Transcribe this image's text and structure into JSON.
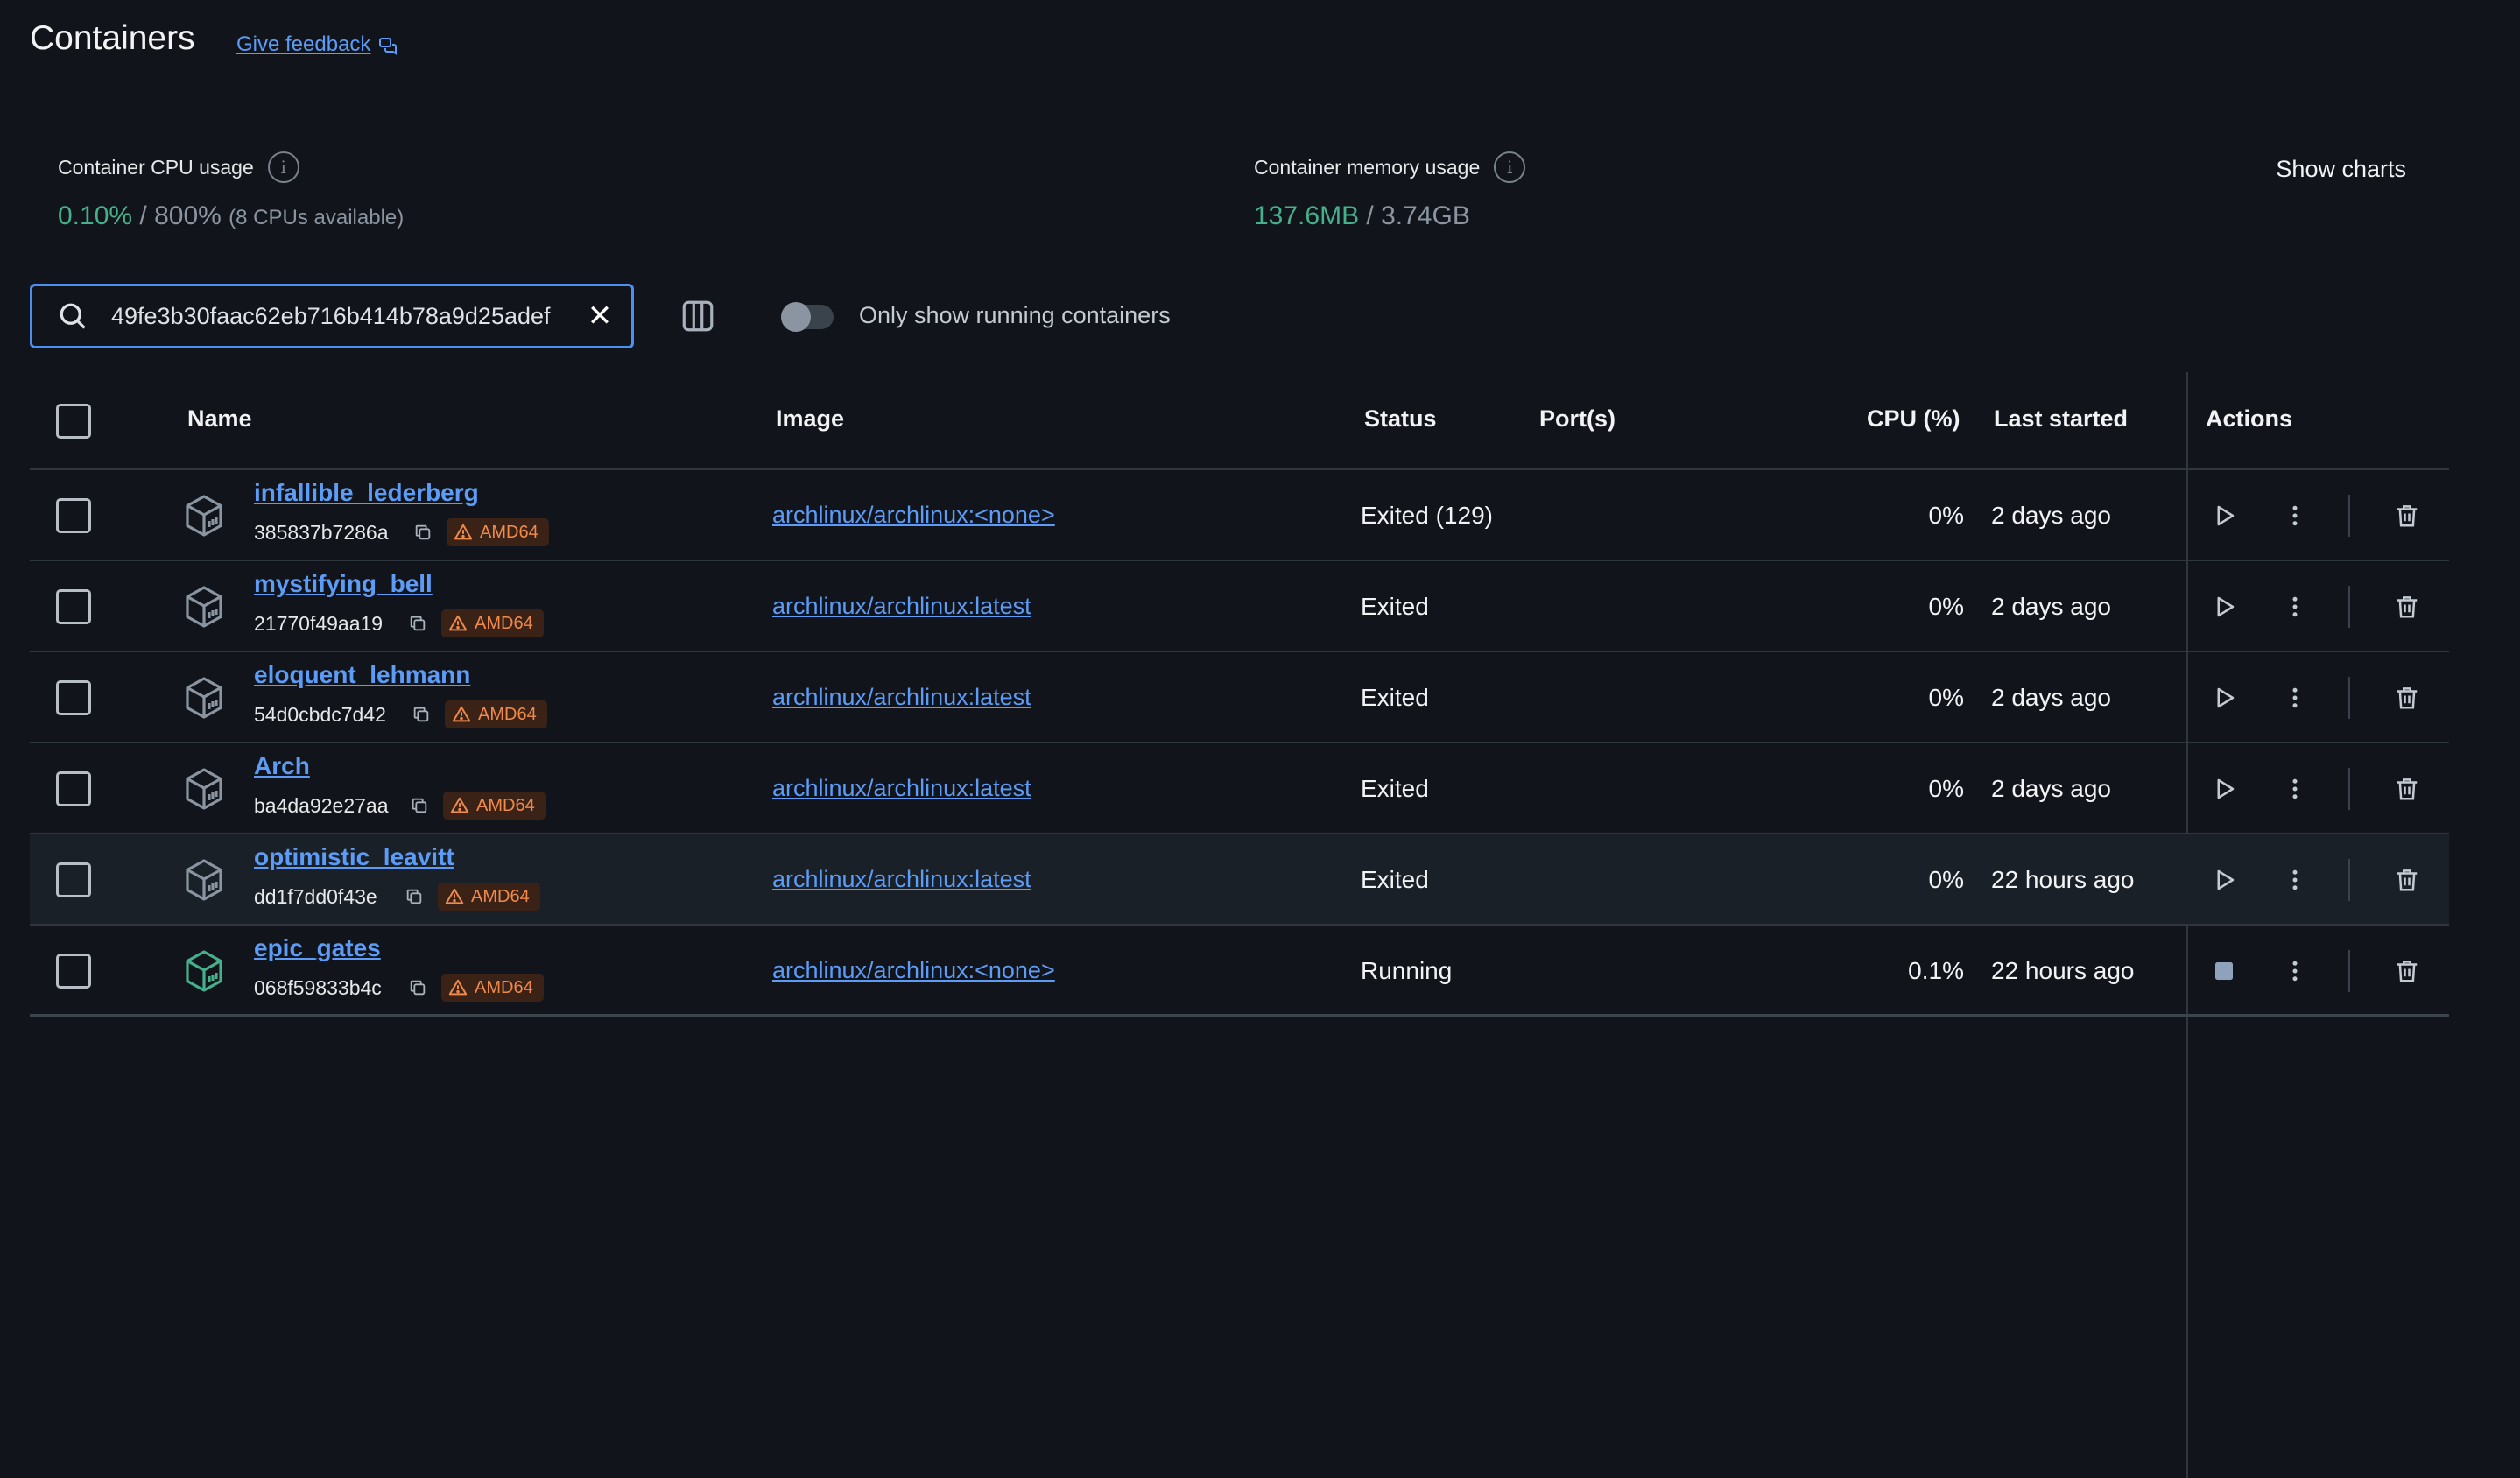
{
  "header": {
    "title": "Containers",
    "feedback_label": "Give feedback"
  },
  "stats": {
    "cpu_label": "Container CPU usage",
    "cpu_used": "0.10%",
    "cpu_sep": " / ",
    "cpu_total": "800%",
    "cpu_note": "(8 CPUs available)",
    "mem_label": "Container memory usage",
    "mem_used": "137.6MB",
    "mem_sep": " / ",
    "mem_total": "3.74GB",
    "show_charts_label": "Show charts"
  },
  "toolbar": {
    "search_value": "49fe3b30faac62eb716b414b78a9d25adef",
    "running_only_label": "Only show running containers",
    "running_only": false
  },
  "table": {
    "columns": {
      "name": "Name",
      "image": "Image",
      "status": "Status",
      "ports": "Port(s)",
      "cpu": "CPU (%)",
      "last_started": "Last started",
      "actions": "Actions"
    },
    "rows": [
      {
        "name": "infallible_lederberg",
        "id": "385837b7286a",
        "arch": "AMD64",
        "image": "archlinux/archlinux:<none>",
        "status": "Exited (129)",
        "cpu": "0%",
        "last_started": "2 days ago",
        "running": false
      },
      {
        "name": "mystifying_bell",
        "id": "21770f49aa19",
        "arch": "AMD64",
        "image": "archlinux/archlinux:latest",
        "status": "Exited",
        "cpu": "0%",
        "last_started": "2 days ago",
        "running": false
      },
      {
        "name": "eloquent_lehmann",
        "id": "54d0cbdc7d42",
        "arch": "AMD64",
        "image": "archlinux/archlinux:latest",
        "status": "Exited",
        "cpu": "0%",
        "last_started": "2 days ago",
        "running": false
      },
      {
        "name": "Arch",
        "id": "ba4da92e27aa",
        "arch": "AMD64",
        "image": "archlinux/archlinux:latest",
        "status": "Exited",
        "cpu": "0%",
        "last_started": "2 days ago",
        "running": false
      },
      {
        "name": "optimistic_leavitt",
        "id": "dd1f7dd0f43e",
        "arch": "AMD64",
        "image": "archlinux/archlinux:latest",
        "status": "Exited",
        "cpu": "0%",
        "last_started": "22 hours ago",
        "running": false
      },
      {
        "name": "epic_gates",
        "id": "068f59833b4c",
        "arch": "AMD64",
        "image": "archlinux/archlinux:<none>",
        "status": "Running",
        "cpu": "0.1%",
        "last_started": "22 hours ago",
        "running": true
      }
    ]
  },
  "colors": {
    "accent": "#4b8ff0",
    "link": "#5d9cf6",
    "running": "#45b08a",
    "warning": "#f08a4b",
    "background": "#11151b"
  },
  "icons": {
    "feedback": "chat-bubble-icon",
    "info": "info-icon",
    "search": "search-icon",
    "clear": "close-icon",
    "columns": "columns-icon",
    "container": "container-cube-icon",
    "copy": "copy-icon",
    "warning": "warning-triangle-icon",
    "start": "play-icon",
    "stop": "stop-icon",
    "more": "kebab-menu-icon",
    "delete": "trash-icon"
  }
}
